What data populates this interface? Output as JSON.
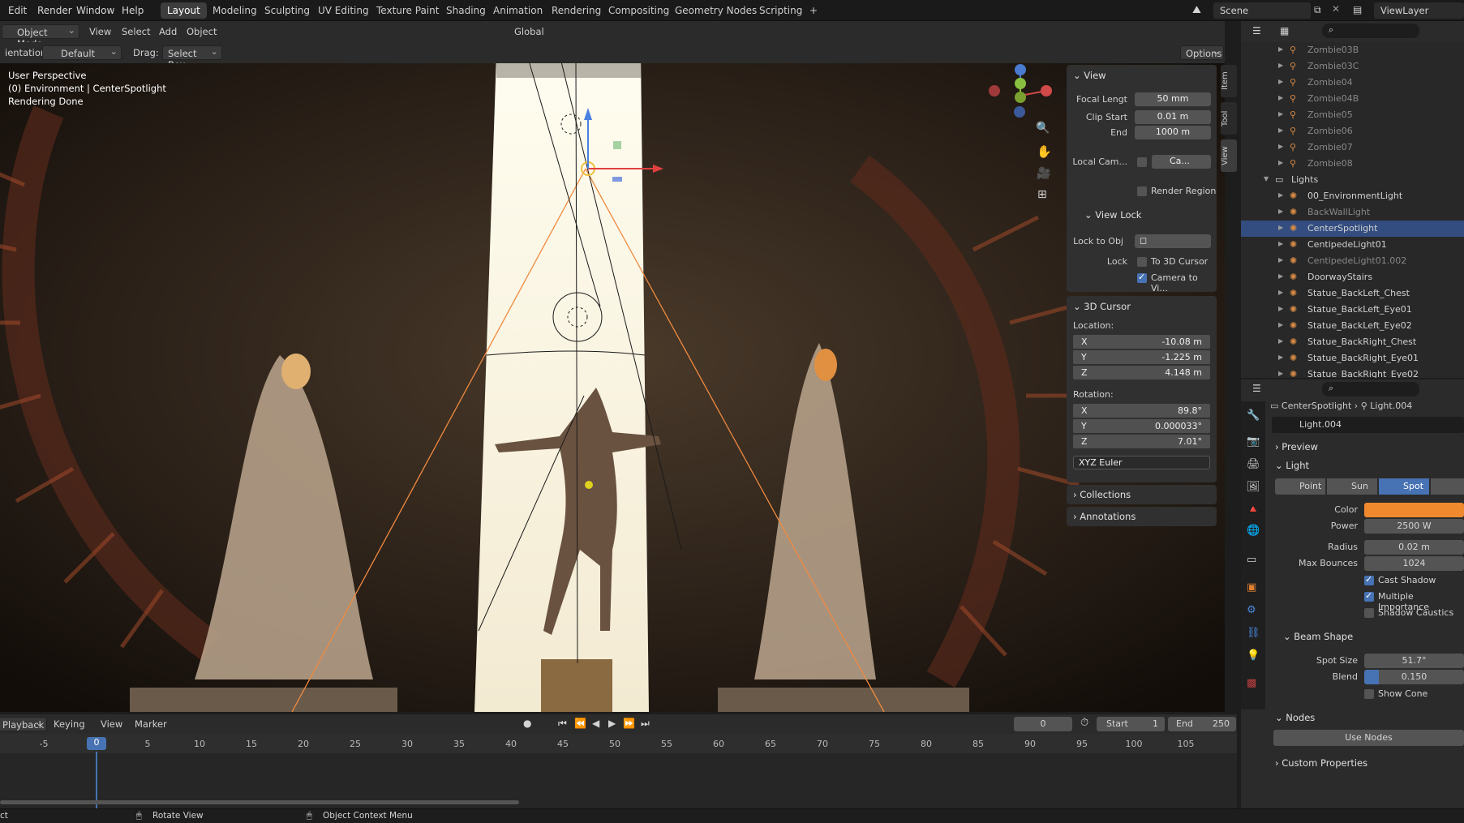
{
  "menu": {
    "edit": "Edit",
    "render": "Render",
    "window": "Window",
    "help": "Help"
  },
  "workspaces": [
    "Layout",
    "Modeling",
    "Sculpting",
    "UV Editing",
    "Texture Paint",
    "Shading",
    "Animation",
    "Rendering",
    "Compositing",
    "Geometry Nodes",
    "Scripting",
    "+"
  ],
  "scene": "Scene",
  "view_layer": "ViewLayer",
  "header": {
    "mode": "Object Mode",
    "view": "View",
    "select": "Select",
    "add": "Add",
    "object": "Object",
    "orientation_global": "Global",
    "options": "Options"
  },
  "header2": {
    "orientation_label": "ientation:",
    "orientation_value": "Default",
    "drag_label": "Drag:",
    "drag_value": "Select Box"
  },
  "viewport": {
    "line1": "User Perspective",
    "line2": "(0) Environment | CenterSpotlight",
    "line3": "Rendering Done"
  },
  "npanel": {
    "view_title": "View",
    "focal_label": "Focal Lengt",
    "focal": "50 mm",
    "clip_start_label": "Clip Start",
    "clip_start": "0.01 m",
    "end_label": "End",
    "clip_end": "1000 m",
    "local_cam_label": "Local Cam...",
    "local_cam_field": "Ca...",
    "render_region": "Render Region",
    "view_lock_title": "View Lock",
    "lock_to_obj_label": "Lock to Obj",
    "lock_label": "Lock",
    "to_3d_cursor": "To 3D Cursor",
    "camera_to_view": "Camera to Vi...",
    "cursor_title": "3D Cursor",
    "location_label": "Location:",
    "loc_x": "-10.08 m",
    "loc_y": "-1.225 m",
    "loc_z": "4.148 m",
    "rotation_label": "Rotation:",
    "rot_x": "89.8°",
    "rot_y": "0.000033°",
    "rot_z": "7.01°",
    "rot_mode": "XYZ Euler",
    "collections": "Collections",
    "annotations": "Annotations",
    "axis_x": "X",
    "axis_y": "Y",
    "axis_z": "Z",
    "tabs": [
      "Item",
      "Tool",
      "View"
    ]
  },
  "outliner": {
    "rows": [
      {
        "name": "Zombie03B",
        "dim": true
      },
      {
        "name": "Zombie03C",
        "dim": true
      },
      {
        "name": "Zombie04",
        "dim": true
      },
      {
        "name": "Zombie04B",
        "dim": true
      },
      {
        "name": "Zombie05",
        "dim": true
      },
      {
        "name": "Zombie06",
        "dim": true
      },
      {
        "name": "Zombie07",
        "dim": true
      },
      {
        "name": "Zombie08",
        "dim": true
      },
      {
        "name": "Lights",
        "dim": false
      },
      {
        "name": "00_EnvironmentLight",
        "dim": false
      },
      {
        "name": "BackWallLight",
        "dim": true
      },
      {
        "name": "CenterSpotlight",
        "dim": false
      },
      {
        "name": "CentipedeLight01",
        "dim": false
      },
      {
        "name": "CentipedeLight01.002",
        "dim": true
      },
      {
        "name": "DoorwayStairs",
        "dim": false
      },
      {
        "name": "Statue_BackLeft_Chest",
        "dim": false
      },
      {
        "name": "Statue_BackLeft_Eye01",
        "dim": false
      },
      {
        "name": "Statue_BackLeft_Eye02",
        "dim": false
      },
      {
        "name": "Statue_BackRight_Chest",
        "dim": false
      },
      {
        "name": "Statue_BackRight_Eye01",
        "dim": false
      },
      {
        "name": "Statue_BackRight_Eye02",
        "dim": false
      }
    ]
  },
  "props": {
    "breadcrumb_obj": "CenterSpotlight",
    "breadcrumb_data": "Light.004",
    "datablock": "Light.004",
    "preview": "Preview",
    "light": "Light",
    "point": "Point",
    "sun": "Sun",
    "spot": "Spot",
    "color_label": "Color",
    "color": "#f0892e",
    "power_label": "Power",
    "power": "2500 W",
    "radius_label": "Radius",
    "radius": "0.02 m",
    "max_bounces_label": "Max Bounces",
    "max_bounces": "1024",
    "cast_shadow": "Cast Shadow",
    "multiple_importance": "Multiple Importance",
    "shadow_caustics": "Shadow Caustics",
    "beam_shape": "Beam Shape",
    "spot_size_label": "Spot Size",
    "spot_size": "51.7°",
    "blend_label": "Blend",
    "blend": "0.150",
    "blend_fraction": 0.15,
    "show_cone": "Show Cone",
    "nodes": "Nodes",
    "use_nodes": "Use Nodes",
    "custom_properties": "Custom Properties"
  },
  "timeline": {
    "playback": "Playback",
    "keying": "Keying",
    "view": "View",
    "marker": "Marker",
    "current_frame": "0",
    "start_label": "Start",
    "start": "1",
    "end_label": "End",
    "end": "250",
    "ticks": [
      "-5",
      "0",
      "5",
      "10",
      "15",
      "20",
      "25",
      "30",
      "35",
      "40",
      "45",
      "50",
      "55",
      "60",
      "65",
      "70",
      "75",
      "80",
      "85",
      "90",
      "95",
      "100",
      "105"
    ],
    "playhead": "0"
  },
  "status": {
    "left": "ct",
    "rotate_view": "Rotate View",
    "context_menu": "Object Context Menu"
  }
}
